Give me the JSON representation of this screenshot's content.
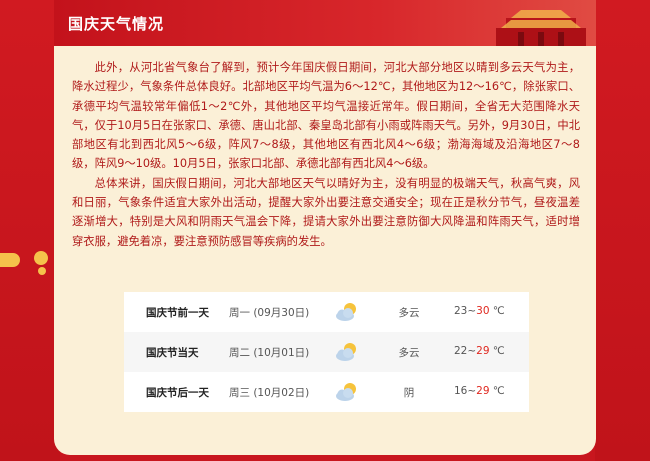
{
  "header": {
    "title": "国庆天气情况"
  },
  "paragraphs": [
    "此外，从河北省气象台了解到，预计今年国庆假日期间，河北大部分地区以晴到多云天气为主，降水过程少，气象条件总体良好。北部地区平均气温为6～12℃，其他地区为12～16℃，除张家口、承德平均气温较常年偏低1～2℃外，其他地区平均气温接近常年。假日期间，全省无大范围降水天气，仅于10月5日在张家口、承德、唐山北部、秦皇岛北部有小雨或阵雨天气。另外，9月30日，中北部地区有北到西北风5～6级，阵风7～8级，其他地区有西北风4～6级；渤海海域及沿海地区7～8级，阵风9～10级。10月5日，张家口北部、承德北部有西北风4～6级。",
    "总体来讲，国庆假日期间，河北大部地区天气以晴好为主，没有明显的极端天气，秋高气爽，风和日丽，气象条件适宜大家外出活动，提醒大家外出要注意交通安全；现在正是秋分节气，昼夜温差逐渐增大，特别是大风和阴雨天气温会下降，提请大家外出要注意防御大风降温和阵雨天气，适时增穿衣服，避免着凉，要注意预防感冒等疾病的发生。"
  ],
  "weather": [
    {
      "name": "国庆节前一天",
      "date": "周一 (09月30日)",
      "icon": "partly-cloudy-icon",
      "desc": "多云",
      "low": "23~",
      "high": "30",
      "unit": " ℃"
    },
    {
      "name": "国庆节当天",
      "date": "周二 (10月01日)",
      "icon": "partly-cloudy-icon",
      "desc": "多云",
      "low": "22~",
      "high": "29",
      "unit": " ℃"
    },
    {
      "name": "国庆节后一天",
      "date": "周三 (10月02日)",
      "icon": "partly-cloudy-icon",
      "desc": "阴",
      "low": "16~",
      "high": "29",
      "unit": " ℃"
    }
  ],
  "colors": {
    "red": "#c8161e",
    "card": "#fbf0d7",
    "text": "#b01a1a",
    "accent": "#e0281f",
    "gold": "#f5c24b"
  }
}
